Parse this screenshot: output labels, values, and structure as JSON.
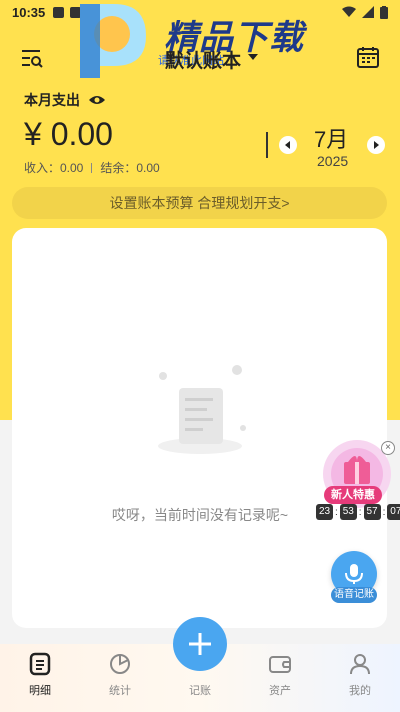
{
  "status_bar": {
    "time": "10:35"
  },
  "watermark": {
    "title": "精品下载",
    "subtitle": "请认准此网站"
  },
  "header": {
    "ledger_name": "默认账本"
  },
  "summary": {
    "label": "本月支出",
    "amount": "¥ 0.00",
    "income_label": "收入：0.00",
    "balance_label": "结余：0.00"
  },
  "period": {
    "month": "7月",
    "year": "2025"
  },
  "budget_tip": "设置账本预算 合理规划开支>",
  "empty_state": {
    "message": "哎呀，当前时间没有记录呢~"
  },
  "promo": {
    "label": "新人特惠",
    "countdown": [
      "23",
      "53",
      "57",
      "07"
    ]
  },
  "voice": {
    "label": "语音记账"
  },
  "tabbar": {
    "items": [
      {
        "label": "明细",
        "icon": "detail-icon"
      },
      {
        "label": "统计",
        "icon": "pie-chart-icon"
      },
      {
        "label": "记账",
        "icon": "plus-icon"
      },
      {
        "label": "资产",
        "icon": "wallet-icon"
      },
      {
        "label": "我的",
        "icon": "user-icon"
      }
    ]
  },
  "colors": {
    "primary_yellow": "#ffe14f",
    "accent_blue": "#4aa6f0",
    "promo_pink": "#e63b7a"
  }
}
